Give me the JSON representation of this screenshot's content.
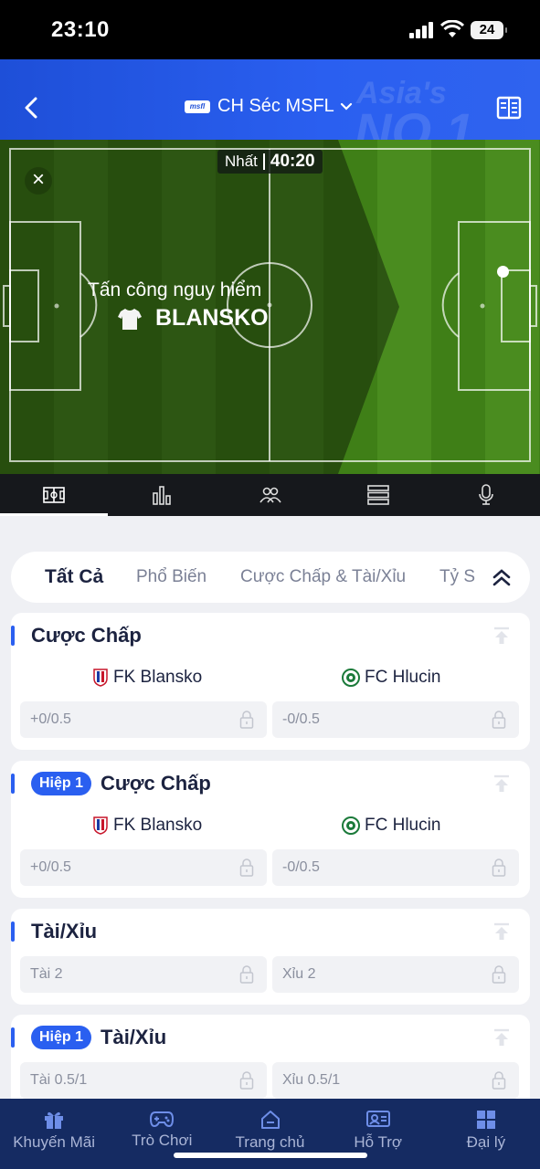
{
  "status_bar": {
    "time": "23:10",
    "battery": "24"
  },
  "header": {
    "league": "CH Séc MSFL",
    "logo_text": "msfl",
    "bg_text_1": "Asia's",
    "bg_text_2": "NO 1"
  },
  "match": {
    "period": "Nhất",
    "clock": "40:20",
    "event_label": "Tấn công nguy hiểm",
    "event_team": "BLANSKO"
  },
  "media_tabs": [
    "field-icon",
    "stats-icon",
    "lineup-icon",
    "list-icon",
    "mic-icon"
  ],
  "filter_tabs": [
    "Tất Cả",
    "Phổ Biến",
    "Cược Chấp & Tài/Xỉu",
    "Tỷ S"
  ],
  "markets": [
    {
      "pill": "",
      "title": "Cược Chấp",
      "home": "FK Blansko",
      "away": "FC Hlucin",
      "left": "+0/0.5",
      "right": "-0/0.5"
    },
    {
      "pill": "Hiệp 1",
      "title": "Cược Chấp",
      "home": "FK Blansko",
      "away": "FC Hlucin",
      "left": "+0/0.5",
      "right": "-0/0.5"
    },
    {
      "pill": "",
      "title": "Tài/Xỉu",
      "left": "Tài 2",
      "right": "Xỉu 2"
    },
    {
      "pill": "Hiệp 1",
      "title": "Tài/Xỉu",
      "left": "Tài 0.5/1",
      "right": "Xỉu 0.5/1"
    }
  ],
  "bottom_nav": [
    "Khuyến Mãi",
    "Trò Chơi",
    "Trang chủ",
    "Hỗ Trợ",
    "Đại lý"
  ],
  "colors": {
    "accent": "#2a5ff0",
    "nav_bg": "#152b62",
    "pitch": "#4a8c1f"
  }
}
